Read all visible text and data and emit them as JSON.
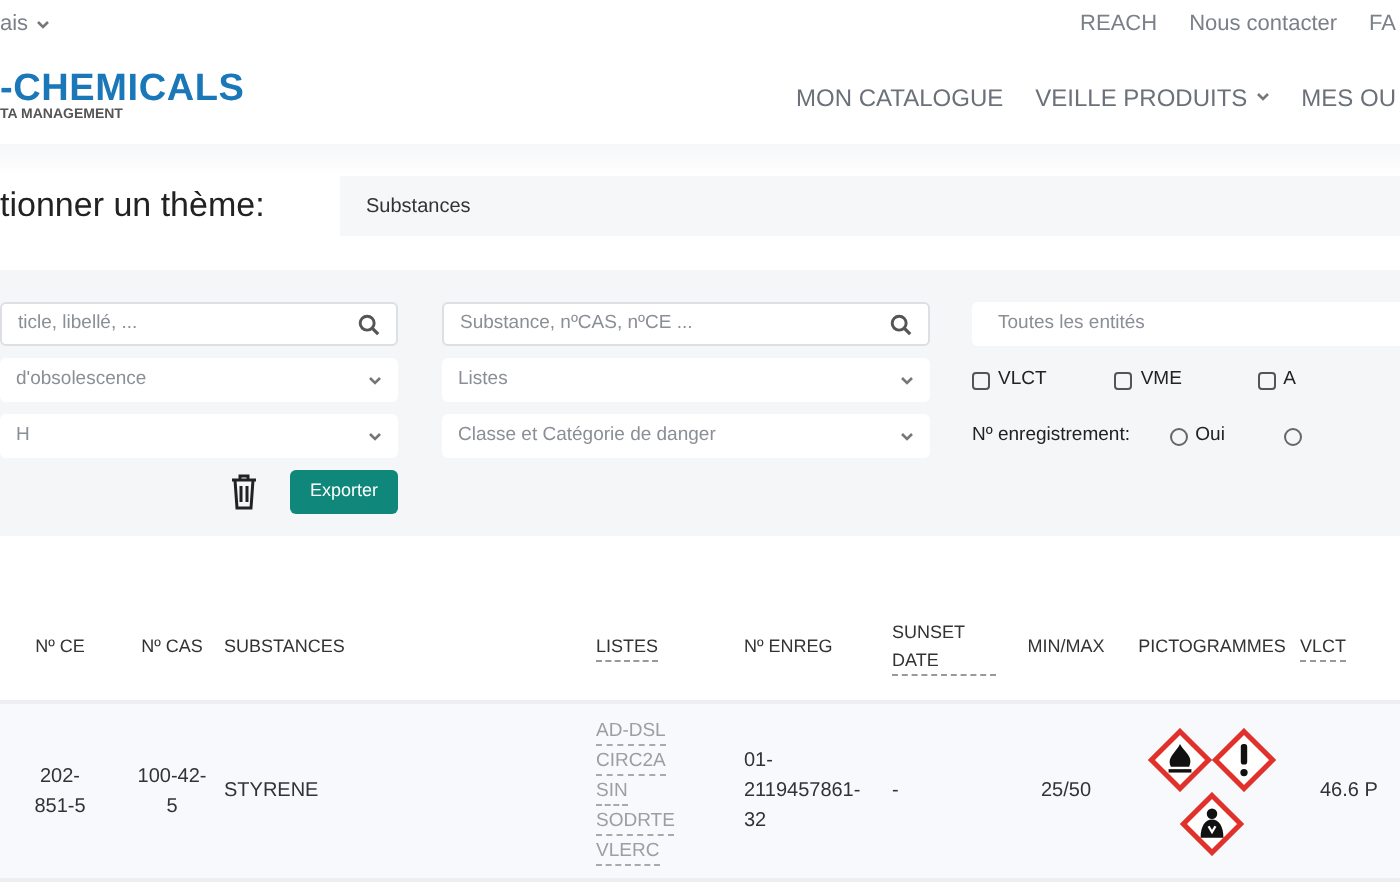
{
  "language_menu": {
    "label": "ais"
  },
  "top_links": [
    "REACH",
    "Nous contacter",
    "FA"
  ],
  "logo": {
    "title": "-CHEMICALS",
    "subtitle": "TA MANAGEMENT"
  },
  "nav": [
    {
      "label": "MON CATALOGUE",
      "dropdown": false
    },
    {
      "label": "VEILLE PRODUITS",
      "dropdown": true
    },
    {
      "label": "MES OU",
      "dropdown": false
    }
  ],
  "theme": {
    "label": "tionner un thème:",
    "value": "Substances"
  },
  "filters": {
    "column_1": [
      {
        "kind": "search",
        "placeholder": "ticle, libellé, ..."
      },
      {
        "kind": "select",
        "placeholder": "d'obsolescence"
      },
      {
        "kind": "select",
        "placeholder": "H"
      }
    ],
    "column_2": [
      {
        "kind": "search",
        "placeholder": "Substance, nºCAS, nºCE ..."
      },
      {
        "kind": "select",
        "placeholder": "Listes"
      },
      {
        "kind": "select",
        "placeholder": "Classe et Catégorie de danger"
      }
    ],
    "entity_field": {
      "placeholder": "Toutes les entités"
    },
    "checkboxes": [
      {
        "label": "VLCT",
        "checked": false
      },
      {
        "label": "VME",
        "checked": false
      },
      {
        "label": "A",
        "checked": false
      }
    ],
    "registration": {
      "label": "Nº enregistrement:",
      "options": [
        {
          "label": "Oui",
          "selected": false
        },
        {
          "selected": false
        }
      ]
    },
    "export_button": "Exporter"
  },
  "table": {
    "columns": [
      {
        "label": "Nº CE",
        "underlined": false
      },
      {
        "label": "Nº CAS",
        "underlined": false
      },
      {
        "label": "SUBSTANCES",
        "underlined": false
      },
      {
        "label": "LISTES",
        "underlined": true
      },
      {
        "label": "Nº ENREG",
        "underlined": false
      },
      {
        "label": "SUNSET DATE",
        "underlined": true
      },
      {
        "label": "MIN/MAX",
        "underlined": false
      },
      {
        "label": "PICTOGRAMMES",
        "underlined": false
      },
      {
        "label": "VLCT",
        "underlined": true
      }
    ],
    "rows": [
      {
        "ce": "202-851-5",
        "cas": "100-42-5",
        "substance": "STYRENE",
        "lists": [
          "AD-DSL",
          "CIRC2A",
          "SIN",
          "SODRTE",
          "VLERC"
        ],
        "enreg": "01-2119457861-32",
        "sunset": "-",
        "minmax": "25/50",
        "pictograms": [
          {
            "kind": "flame"
          },
          {
            "kind": "exclamation"
          },
          {
            "kind": "health_hazard"
          }
        ],
        "vlct": "46.6 P"
      }
    ]
  }
}
